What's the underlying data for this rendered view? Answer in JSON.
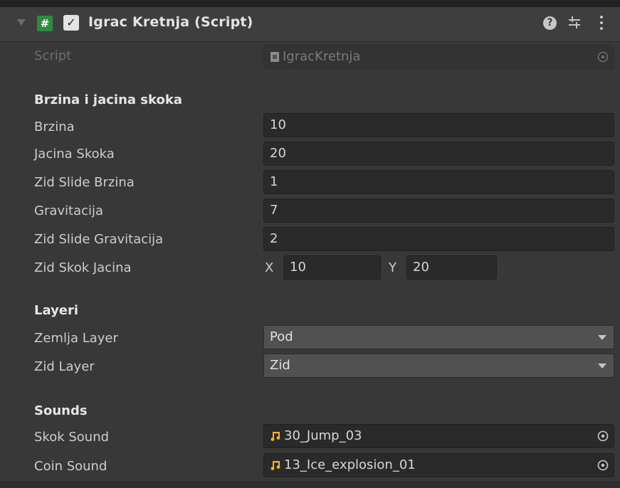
{
  "component": {
    "title": "Igrac Kretnja (Script)",
    "enabled": true
  },
  "script_row": {
    "label": "Script",
    "value": "IgracKretnja"
  },
  "sections": {
    "movement": "Brzina i jacina skoka",
    "layers": "Layeri",
    "sounds": "Sounds"
  },
  "fields": {
    "brzina": {
      "label": "Brzina",
      "value": "10"
    },
    "jacina_skoka": {
      "label": "Jacina Skoka",
      "value": "20"
    },
    "zid_slide_brzina": {
      "label": "Zid Slide Brzina",
      "value": "1"
    },
    "gravitacija": {
      "label": "Gravitacija",
      "value": "7"
    },
    "zid_slide_gravitacija": {
      "label": "Zid Slide Gravitacija",
      "value": "2"
    },
    "zid_skok_jacina": {
      "label": "Zid Skok Jacina",
      "x_label": "X",
      "x": "10",
      "y_label": "Y",
      "y": "20"
    }
  },
  "layers": {
    "zemlja": {
      "label": "Zemlja Layer",
      "value": "Pod"
    },
    "zid": {
      "label": "Zid Layer",
      "value": "Zid"
    }
  },
  "sounds": {
    "skok": {
      "label": "Skok Sound",
      "value": "30_Jump_03"
    },
    "coin": {
      "label": "Coin Sound",
      "value": "13_Ice_explosion_01"
    }
  },
  "icons": {
    "foldout": "foldout-arrow-icon",
    "script": "csharp-script-icon",
    "help": "help-icon",
    "presets": "presets-sliders-icon",
    "menu": "kebab-menu-icon",
    "audio": "audio-clip-icon",
    "picker": "object-picker-icon"
  },
  "colors": {
    "background": "#383838",
    "script_icon": "#2f8a3e",
    "audio_icon": "#f0b429"
  }
}
